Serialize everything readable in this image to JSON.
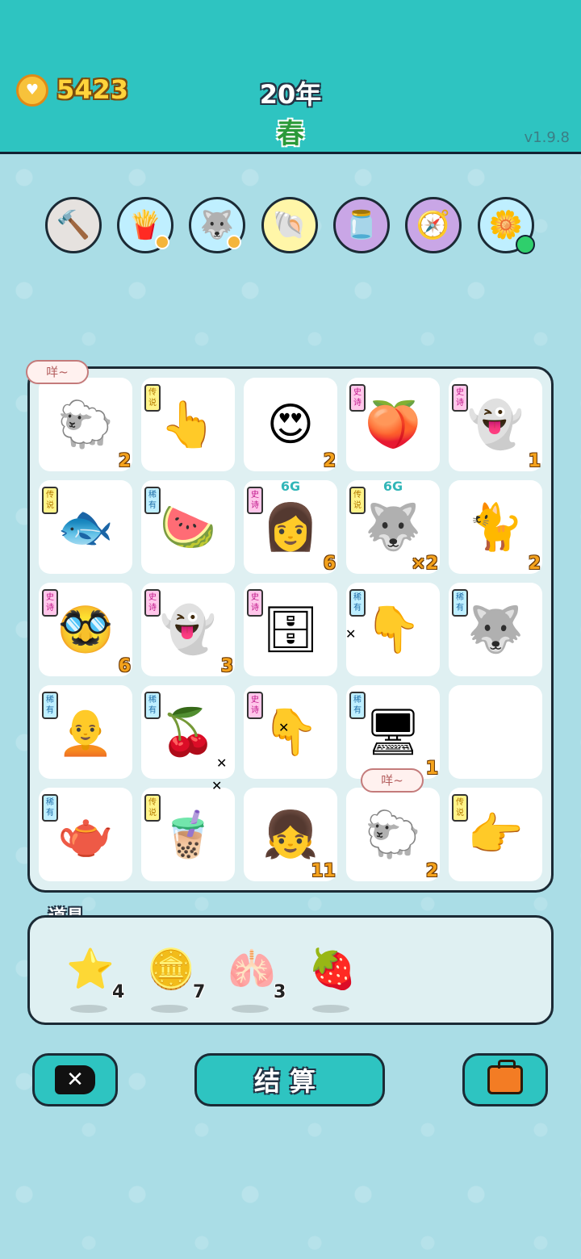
{
  "header": {
    "coins": "5423",
    "year": "20年",
    "season": "春",
    "version": "v1.9.8"
  },
  "toolbar": [
    {
      "name": "hammer",
      "icon": "🔨",
      "bg": "#e6e2df"
    },
    {
      "name": "fries",
      "icon": "🍟",
      "bg": "#bfefff"
    },
    {
      "name": "husky",
      "icon": "🐺",
      "bg": "#bfefff"
    },
    {
      "name": "shell",
      "icon": "🐚",
      "bg": "#fff6a8"
    },
    {
      "name": "jar",
      "icon": "🫙",
      "bg": "#c9a6e6"
    },
    {
      "name": "compass",
      "icon": "🧭",
      "bg": "#c9a6e6"
    },
    {
      "name": "flower-pot",
      "icon": "🌼",
      "bg": "#bfefff"
    }
  ],
  "board": {
    "cells": [
      {
        "art": "🐑",
        "num": "2",
        "badge": "",
        "top": ""
      },
      {
        "art": "👆",
        "num": "",
        "badge": "传说",
        "top": ""
      },
      {
        "art": "😍",
        "num": "2",
        "badge": "",
        "top": ""
      },
      {
        "art": "🍑",
        "num": "",
        "badge": "史诗",
        "top": ""
      },
      {
        "art": "👻",
        "num": "1",
        "badge": "史诗",
        "top": ""
      },
      {
        "art": "🐟",
        "num": "",
        "badge": "传说",
        "top": ""
      },
      {
        "art": "🍉",
        "num": "",
        "badge": "稀有",
        "top": ""
      },
      {
        "art": "👩",
        "num": "6",
        "badge": "史诗",
        "top": "6G"
      },
      {
        "art": "🐺",
        "num": "×2",
        "badge": "传说",
        "top": "6G"
      },
      {
        "art": "🐈",
        "num": "2",
        "badge": "",
        "top": ""
      },
      {
        "art": "🥸",
        "num": "6",
        "badge": "史诗",
        "top": ""
      },
      {
        "art": "👻",
        "num": "3",
        "badge": "史诗",
        "top": ""
      },
      {
        "art": "🗄",
        "num": "",
        "badge": "史诗",
        "top": ""
      },
      {
        "art": "👇",
        "num": "",
        "badge": "稀有",
        "top": ""
      },
      {
        "art": "🐺",
        "num": "",
        "badge": "稀有",
        "top": ""
      },
      {
        "art": "🧑‍🦲",
        "num": "",
        "badge": "稀有",
        "top": ""
      },
      {
        "art": "🍒",
        "num": "",
        "badge": "稀有",
        "top": ""
      },
      {
        "art": "👇",
        "num": "",
        "badge": "史诗",
        "top": ""
      },
      {
        "art": "🖥",
        "num": "1",
        "badge": "稀有",
        "top": ""
      },
      {
        "art": "",
        "num": "",
        "badge": "",
        "top": ""
      },
      {
        "art": "🫖",
        "num": "",
        "badge": "稀有",
        "top": ""
      },
      {
        "art": "🧋",
        "num": "",
        "badge": "传说",
        "top": ""
      },
      {
        "art": "👧",
        "num": "11",
        "badge": "",
        "top": ""
      },
      {
        "art": "🐑",
        "num": "2",
        "badge": "",
        "top": ""
      },
      {
        "art": "👉",
        "num": "",
        "badge": "传说",
        "top": ""
      }
    ],
    "bubble_texts": [
      "咩~",
      "咩~"
    ]
  },
  "props": {
    "label": "道具",
    "items": [
      {
        "icon": "⭐",
        "count": "4"
      },
      {
        "icon": "🪙",
        "count": "7"
      },
      {
        "icon": "🫁",
        "count": "3"
      },
      {
        "icon": "🍓",
        "count": ""
      }
    ]
  },
  "buttons": {
    "settle": "结算"
  }
}
